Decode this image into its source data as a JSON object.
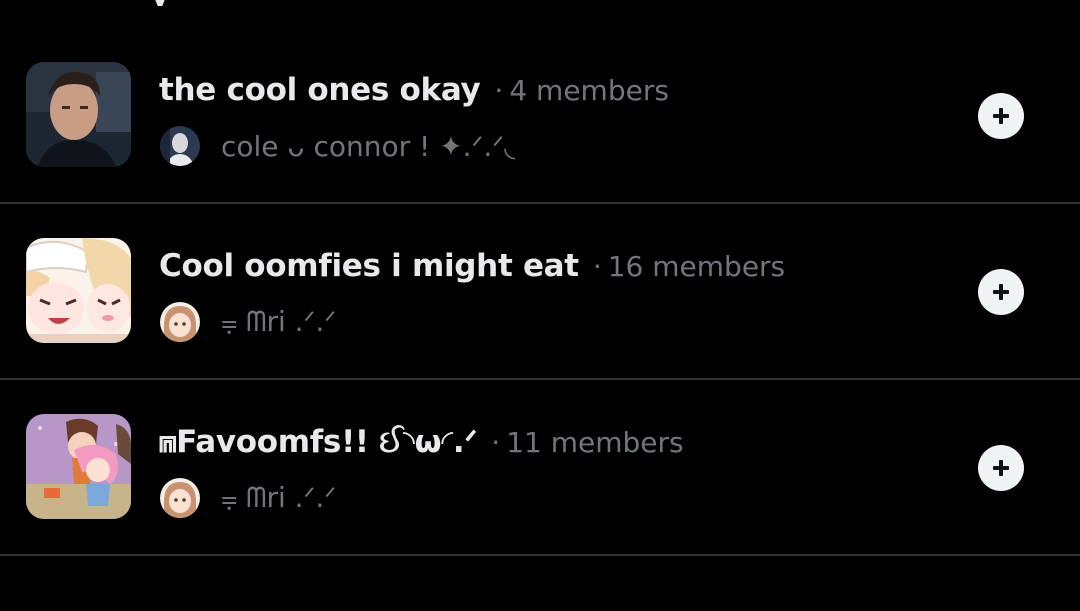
{
  "header": {
    "partial_title": "y"
  },
  "lists": [
    {
      "title": "the cool ones okay",
      "separator": "·",
      "members": "4 members",
      "owner": "cole ᴗ connor ! ✦.ᐟ.ᐟ◟",
      "avatar_icon": "portrait-photo",
      "action_icon": "plus-icon"
    },
    {
      "title": "Cool oomfies i might eat",
      "separator": "·",
      "members": "16 members",
      "owner": "⩦ ᗰri .ᐟ.ᐟ",
      "avatar_icon": "anime-art",
      "action_icon": "plus-icon"
    },
    {
      "title": "⩎Favoomfs!! ઈ◝ω◜.ᐟ",
      "separator": "·",
      "members": "11 members",
      "owner": "⩦ ᗰri .ᐟ.ᐟ",
      "avatar_icon": "anime-art",
      "action_icon": "plus-icon"
    }
  ],
  "colors": {
    "background": "#000000",
    "primary_text": "#e7e9ea",
    "secondary_text": "#71767b",
    "divider": "#2f3336",
    "button_bg": "#eff3f4",
    "button_icon": "#0f1419"
  }
}
